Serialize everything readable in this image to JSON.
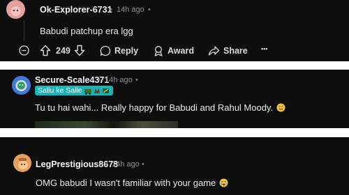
{
  "comments": [
    {
      "username": "Ok-Explorer-6731",
      "separator": "•",
      "time": "14h ago",
      "menu_dot": "•",
      "body": "Babudi patchup era lgg",
      "votes": "249",
      "reply_label": "Reply",
      "award_label": "Award",
      "share_label": "Share",
      "more_label": "•••"
    },
    {
      "username": "Secure-Scale4371",
      "separator": "•",
      "time": "14h ago",
      "menu_dot": "•",
      "flair": "Sallu ke Salle",
      "body": "Tu tu hai wahi... Really happy for Babudi and Rahul Moody."
    },
    {
      "username": "LegPrestigious8678",
      "separator": "•",
      "time": "14h ago",
      "menu_dot": "•",
      "body": "OMG babudi I wasn't familiar with your game"
    }
  ],
  "colors": {
    "background": "#0e0e0f",
    "separator": "#ffffff",
    "flair_bg": "#17b4b8",
    "text": "#d7dadc",
    "meta": "#8b9296"
  },
  "icons": [
    "avatar",
    "collapse-icon",
    "upvote-icon",
    "downvote-icon",
    "comment-icon",
    "award-icon",
    "share-icon",
    "more-icon",
    "smile-emoji",
    "crying-emoji"
  ]
}
